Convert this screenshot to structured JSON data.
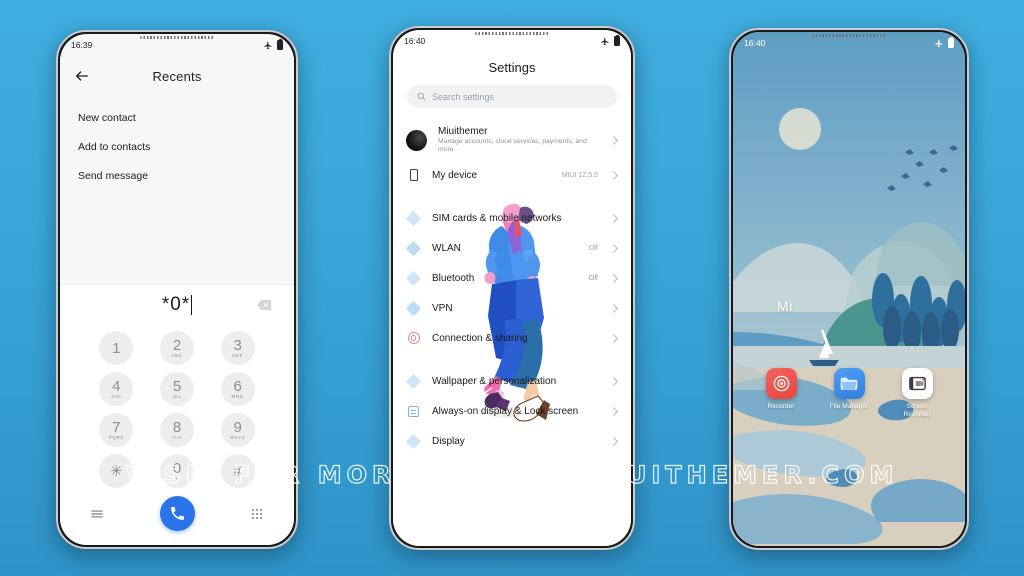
{
  "background": {
    "top_color": "#3FAEE0",
    "bottom_color": "#2E93C8"
  },
  "watermark": {
    "text": "VISIT FOR MORE THEMES   MIUITHEMER.COM"
  },
  "phone1": {
    "status": {
      "time": "16:39",
      "airplane_icon": "airplane-icon",
      "battery_icon": "battery-icon"
    },
    "header": {
      "back_icon": "back-arrow-icon",
      "title": "Recents"
    },
    "menu": [
      {
        "label": "New contact"
      },
      {
        "label": "Add to contacts"
      },
      {
        "label": "Send message"
      }
    ],
    "dialer": {
      "number": "*0*",
      "backspace_icon": "backspace-icon",
      "keys": [
        {
          "num": "1",
          "sub": ""
        },
        {
          "num": "2",
          "sub": "ABC"
        },
        {
          "num": "3",
          "sub": "DEF"
        },
        {
          "num": "4",
          "sub": "GHI"
        },
        {
          "num": "5",
          "sub": "JKL"
        },
        {
          "num": "6",
          "sub": "MNO"
        },
        {
          "num": "7",
          "sub": "PQRS"
        },
        {
          "num": "8",
          "sub": "TUV"
        },
        {
          "num": "9",
          "sub": "WXYZ"
        },
        {
          "num": "✳",
          "sub": ""
        },
        {
          "num": "0",
          "sub": "+"
        },
        {
          "num": "#",
          "sub": ""
        }
      ],
      "menu_icon": "hamburger-icon",
      "call_icon": "phone-call-icon",
      "call_button_color": "#2a73e8",
      "keypad_icon": "keypad-grid-icon"
    }
  },
  "phone2": {
    "status": {
      "time": "16:40",
      "airplane_icon": "airplane-icon",
      "battery_icon": "battery-icon"
    },
    "title": "Settings",
    "search": {
      "icon": "search-icon",
      "placeholder": "Search settings"
    },
    "account": {
      "avatar_icon": "account-avatar",
      "name": "Miuithemer",
      "desc": "Manage accounts, cloud services, payments, and more",
      "chevron": "chevron-right-icon"
    },
    "device": {
      "icon": "device-icon",
      "name": "My device",
      "value": "MIUI 12.5.5",
      "chevron": "chevron-right-icon"
    },
    "items": [
      {
        "icon": "diamond-icon",
        "name": "SIM cards & mobile networks",
        "value": ""
      },
      {
        "icon": "diamond-icon",
        "name": "WLAN",
        "value": "Off"
      },
      {
        "icon": "diamond-icon",
        "name": "Bluetooth",
        "value": "Off"
      },
      {
        "icon": "diamond-icon",
        "name": "VPN",
        "value": ""
      },
      {
        "icon": "connection-sharing-icon",
        "name": "Connection & sharing",
        "value": ""
      }
    ],
    "items2": [
      {
        "icon": "diamond-icon",
        "name": "Wallpaper & personalization",
        "value": ""
      },
      {
        "icon": "always-on-display-icon",
        "name": "Always-on display & Lock screen",
        "value": ""
      },
      {
        "icon": "diamond-icon",
        "name": "Display",
        "value": ""
      }
    ]
  },
  "phone3": {
    "status": {
      "time": "16:40",
      "airplane_icon": "airplane-icon",
      "battery_icon": "battery-icon"
    },
    "widget": {
      "label": "Mi"
    },
    "apps": [
      {
        "label": "Recorder",
        "icon": "recorder-icon",
        "color": "#e8453f"
      },
      {
        "label": "File Manager",
        "icon": "file-manager-icon",
        "color": "#2f7fe0"
      },
      {
        "label": "Screen Recorder",
        "icon": "screen-recorder-icon",
        "color": "#ffffff"
      }
    ]
  }
}
